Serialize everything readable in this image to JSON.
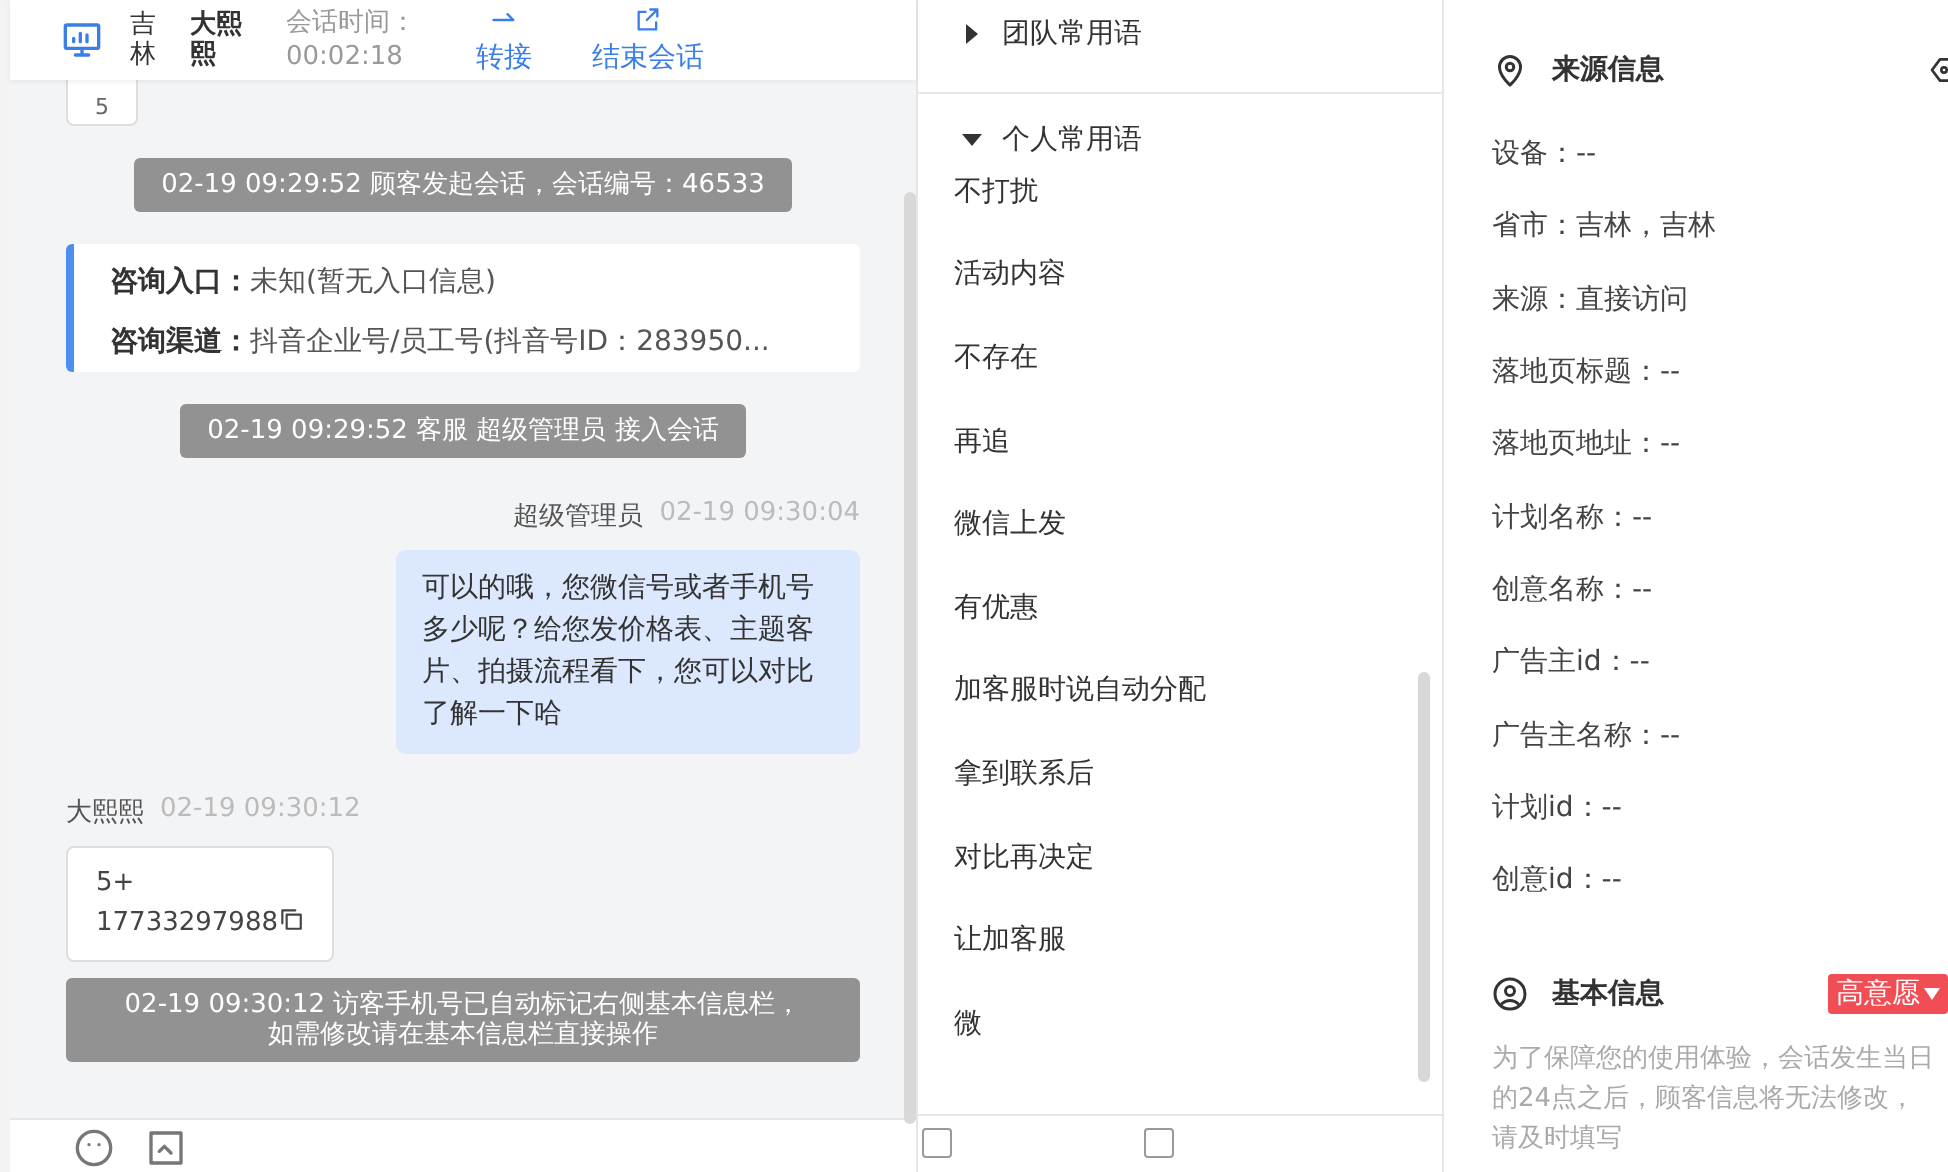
{
  "header": {
    "location": "吉林",
    "name": "大熙熙",
    "timer_label": "会话时间：",
    "timer": "00:02:18",
    "actions": [
      {
        "kind": "transfer",
        "label": "转接"
      },
      {
        "kind": "end",
        "label": "结束会话"
      }
    ]
  },
  "chat": {
    "top_card": "5",
    "messages": [
      {
        "kind": "system",
        "text": "02-19 09:29:52 顾客发起会话，会话编号：46533"
      },
      {
        "kind": "info",
        "rows": [
          {
            "label": "咨询入口：",
            "value": "未知(暂无入口信息)"
          },
          {
            "label": "咨询渠道：",
            "value": "抖音企业号/员工号(抖音号ID：283950..."
          }
        ]
      },
      {
        "kind": "system",
        "text": "02-19 09:29:52 客服 超级管理员 接入会话"
      },
      {
        "kind": "agent",
        "sender": "超级管理员",
        "time": "02-19 09:30:04",
        "text": "可以的哦，您微信号或者手机号多少呢？给您发价格表、主题客片、拍摄流程看下，您可以对比了解一下哈"
      },
      {
        "kind": "visitor",
        "sender": "大熙熙",
        "time": "02-19 09:30:12",
        "lines": [
          "5+",
          "17733297988"
        ]
      },
      {
        "kind": "notice",
        "lines": [
          "02-19 09:30:12 访客手机号已自动标记右侧基本信息栏，",
          "如需修改请在基本信息栏直接操作"
        ]
      }
    ]
  },
  "quick_replies": {
    "groups": [
      {
        "title": "团队常用语",
        "expanded": false
      },
      {
        "title": "个人常用语",
        "expanded": true,
        "items": [
          "不打扰",
          "活动内容",
          "不存在",
          "再追",
          "微信上发",
          "有优惠",
          "加客服时说自动分配",
          "拿到联系后",
          "对比再决定",
          "让加客服",
          "微"
        ]
      }
    ],
    "options": [
      {
        "checked": false
      },
      {
        "checked": false
      }
    ]
  },
  "source_info": {
    "title": "来源信息",
    "fields": [
      "设备：--",
      "省市：吉林，吉林",
      "来源：直接访问",
      "落地页标题：--",
      "落地页地址：--",
      "计划名称：--",
      "创意名称：--",
      "广告主id：--",
      "广告主名称：--",
      "计划id：--",
      "创意id：--"
    ]
  },
  "basic_info": {
    "title": "基本信息",
    "intent": "高意愿",
    "note": "为了保障您的使用体验，会话发生当日的24点之后，顾客信息将无法修改，请及时填写"
  }
}
